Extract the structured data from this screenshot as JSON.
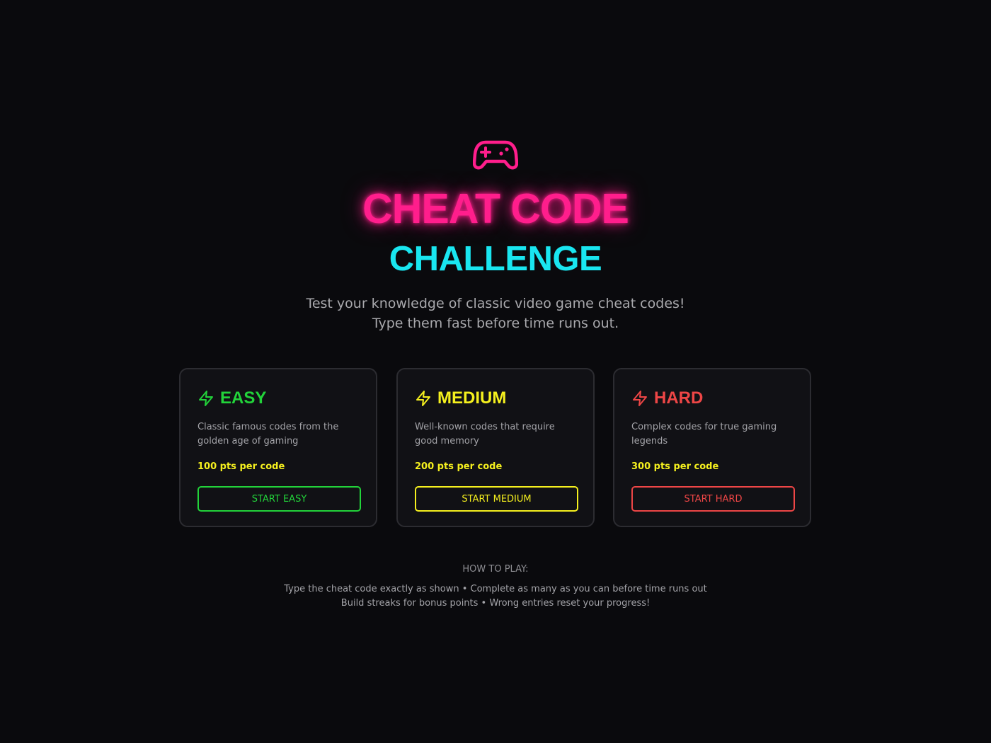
{
  "header": {
    "icon": "gamepad-icon",
    "title": "CHEAT CODE",
    "subtitle": "CHALLENGE",
    "tagline_line1": "Test your knowledge of classic video game cheat codes!",
    "tagline_line2": "Type them fast before time runs out."
  },
  "colors": {
    "background": "#0a0a0d",
    "title": "#ff1e8c",
    "subtitle": "#19e6f0",
    "easy": "#22d33a",
    "medium": "#f5f01e",
    "hard": "#ee4646",
    "points": "#f5f01e"
  },
  "difficulties": [
    {
      "icon": "lightning-icon",
      "title": "EASY",
      "description": "Classic famous codes from the golden age of gaming",
      "points": "100 pts per code",
      "button": "START EASY"
    },
    {
      "icon": "lightning-icon",
      "title": "MEDIUM",
      "description": "Well-known codes that require good memory",
      "points": "200 pts per code",
      "button": "START MEDIUM"
    },
    {
      "icon": "lightning-icon",
      "title": "HARD",
      "description": "Complex codes for true gaming legends",
      "points": "300 pts per code",
      "button": "START HARD"
    }
  ],
  "how_to_play": {
    "heading": "HOW TO PLAY:",
    "line1": "Type the cheat code exactly as shown • Complete as many as you can before time runs out",
    "line2": "Build streaks for bonus points • Wrong entries reset your progress!"
  }
}
